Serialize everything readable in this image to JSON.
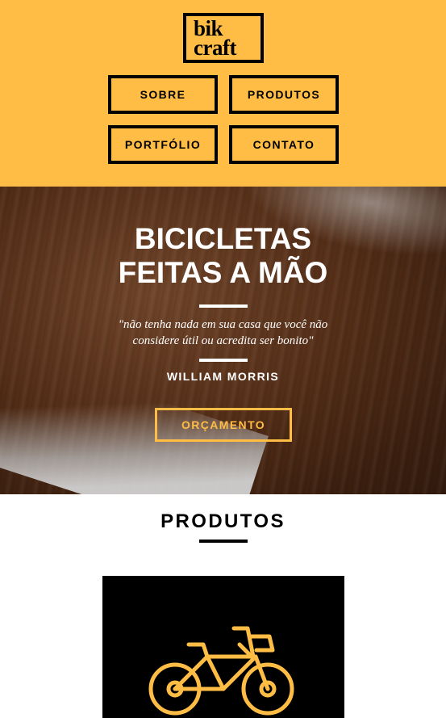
{
  "brand": {
    "logo_line1": "bik",
    "logo_line2": "craft"
  },
  "nav": {
    "items": [
      {
        "label": "SOBRE"
      },
      {
        "label": "PRODUTOS"
      },
      {
        "label": "PORTFÓLIO"
      },
      {
        "label": "CONTATO"
      }
    ]
  },
  "hero": {
    "title_line1": "BICICLETAS",
    "title_line2": "FEITAS A MÃO",
    "quote_line1": "\"não tenha nada em sua casa que você não",
    "quote_line2": "considere útil ou acredita ser bonito\"",
    "author": "WILLIAM MORRIS",
    "cta_label": "ORÇAMENTO"
  },
  "products": {
    "title": "PRODUTOS",
    "first_item_icon": "bicycle-icon"
  },
  "colors": {
    "accent": "#ffbd45",
    "text": "#000000",
    "inverse": "#ffffff"
  }
}
